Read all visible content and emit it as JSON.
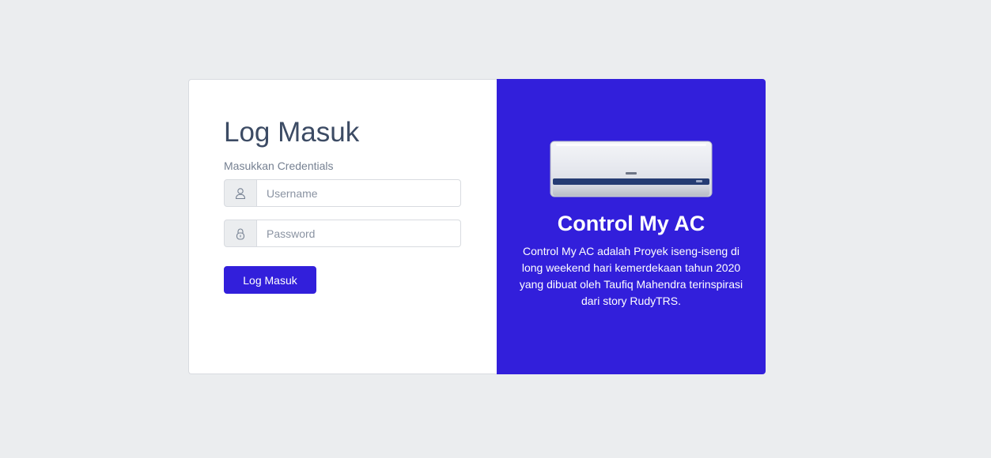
{
  "login": {
    "title": "Log Masuk",
    "subtitle": "Masukkan Credentials",
    "username": {
      "icon": "user-icon",
      "placeholder": "Username",
      "value": ""
    },
    "password": {
      "icon": "lock-icon",
      "placeholder": "Password",
      "value": ""
    },
    "button_label": "Log Masuk"
  },
  "info": {
    "image_icon": "air-conditioner-icon",
    "title": "Control My AC",
    "description": "Control My AC adalah Proyek iseng-iseng di long weekend hari kemerdekaan tahun 2020 yang dibuat oleh Taufiq Mahendra terinspirasi dari story RudyTRS."
  },
  "colors": {
    "background": "#ebedef",
    "primary": "#321fdb",
    "title_text": "#3c4b64",
    "muted_text": "#768192",
    "border": "#d8dbe0"
  }
}
